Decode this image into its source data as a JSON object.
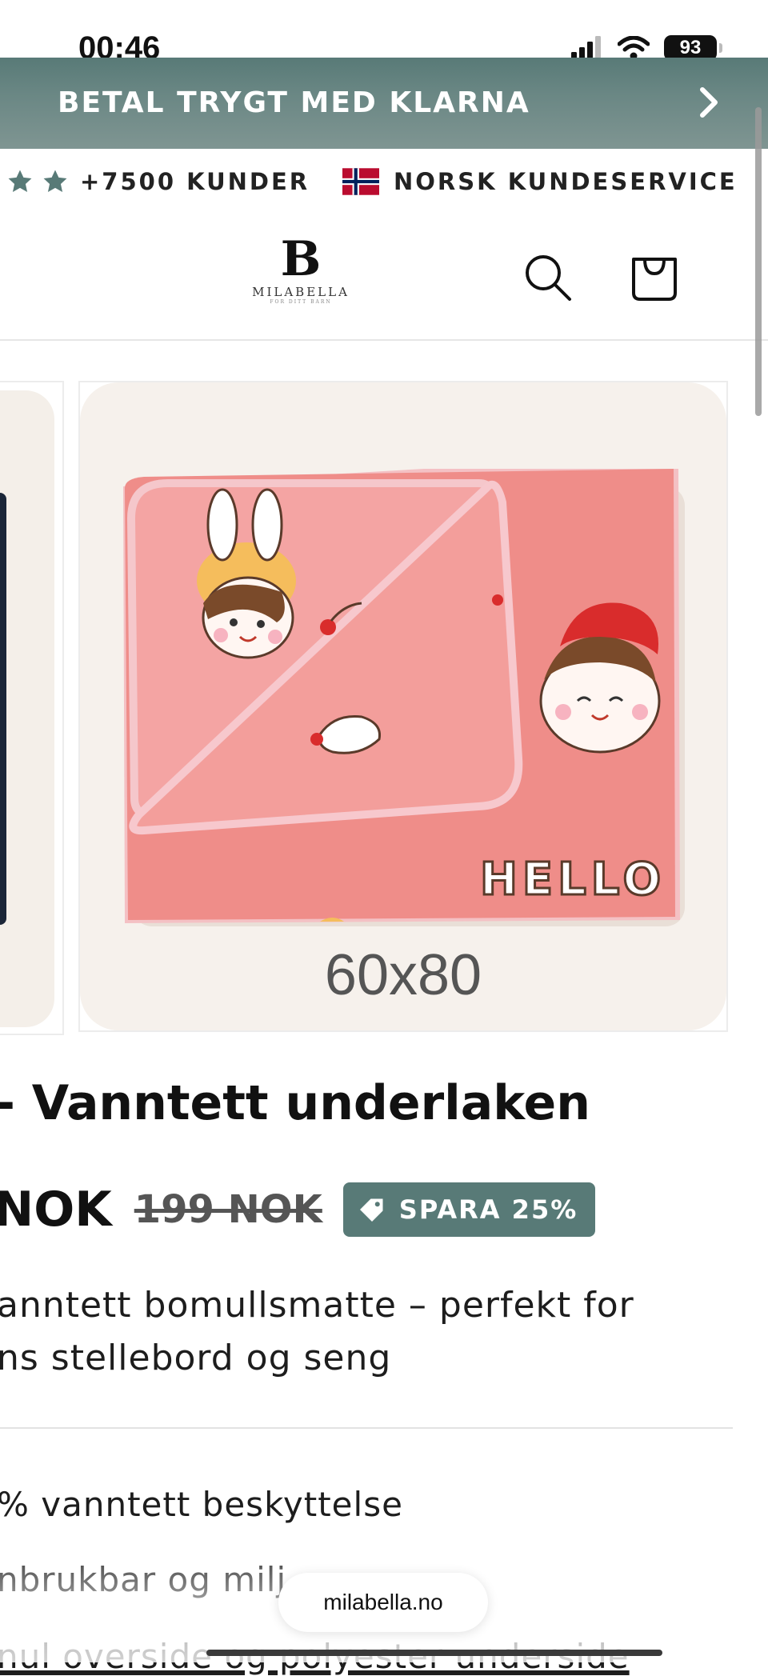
{
  "status_bar": {
    "time": "00:46",
    "battery": "93"
  },
  "promo_banner": {
    "text": "BETAL TRYGT MED KLARNA",
    "arrow_icon": "chevron-right-icon"
  },
  "trust_bar": {
    "customers": "+7500 KUNDER",
    "service": "NORSK KUNDESERVICE"
  },
  "header": {
    "logo": {
      "letter": "B",
      "name": "MILABELLA",
      "tagline": "FOR DITT BARN"
    },
    "search_icon": "search-icon",
    "cart_icon": "cart-icon"
  },
  "gallery": {
    "size_label": "60x80",
    "image_text": "HELLO"
  },
  "product": {
    "title": "- Vanntett underlaken",
    "price": "NOK",
    "compare_price": "199 NOK",
    "discount": "SPARA 25%",
    "description_line1": "anntett bomullsmatte – perfekt for",
    "description_line2": "ns stellebord og seng",
    "features": [
      "% vanntett beskyttelse",
      "nbrukbar og milj",
      "nul overside og polyester underside"
    ]
  },
  "browser": {
    "url": "milabella.no"
  },
  "colors": {
    "accent": "#587a77",
    "product_pink": "#f28a86"
  }
}
